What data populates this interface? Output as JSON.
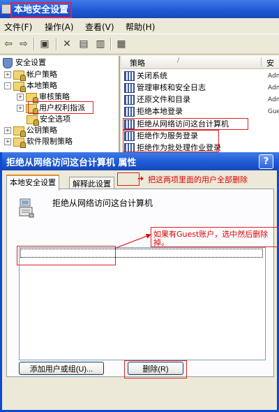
{
  "mmc": {
    "title": "本地安全设置",
    "menu": [
      "文件(F)",
      "操作(A)",
      "查看(V)",
      "帮助(H)"
    ],
    "tree": {
      "root": "安全设置",
      "items": [
        {
          "label": "帐户策略",
          "level": 1,
          "expander": "+"
        },
        {
          "label": "本地策略",
          "level": 1,
          "expander": "-"
        },
        {
          "label": "审核策略",
          "level": 2,
          "expander": "+"
        },
        {
          "label": "用户权利指派",
          "level": 2,
          "expander": "+"
        },
        {
          "label": "安全选项",
          "level": 2,
          "expander": ""
        },
        {
          "label": "公钥策略",
          "level": 1,
          "expander": "+"
        },
        {
          "label": "软件限制策略",
          "level": 1,
          "expander": "+"
        }
      ]
    },
    "list": {
      "col_policy": "策略",
      "col_security": "安",
      "rows": [
        {
          "name": "关闭系统",
          "value": "Adm"
        },
        {
          "name": "管理审核和安全日志",
          "value": "Adm"
        },
        {
          "name": "还原文件和目录",
          "value": "Adm"
        },
        {
          "name": "拒绝本地登录",
          "value": "Gue"
        },
        {
          "name": "拒绝从网络访问这台计算机",
          "value": ""
        },
        {
          "name": "拒绝作为服务登录",
          "value": ""
        },
        {
          "name": "拒绝作为批处理作业登录",
          "value": ""
        }
      ]
    }
  },
  "dialog": {
    "title": "拒绝从网络访问这台计算机 属性",
    "help_glyph": "?",
    "tabs": [
      "本地安全设置",
      "解释此设置"
    ],
    "policy_name": "拒绝从网络访问这台计算机",
    "add_button": "添加用户或组(U)...",
    "remove_button": "删除(R)"
  },
  "annotations": {
    "note1": "把这两项里面的用户全部删除",
    "note2_line1": "如果有Guest账户，选中然后删除",
    "note2_line2": "掉。"
  }
}
